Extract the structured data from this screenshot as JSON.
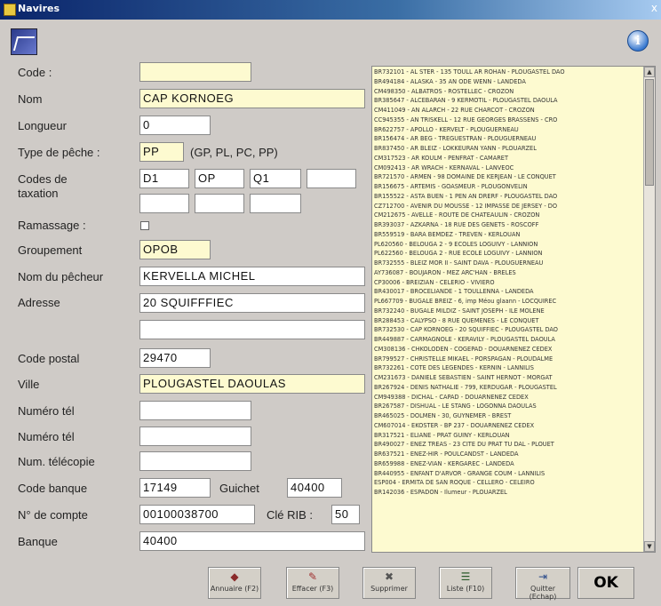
{
  "window": {
    "title": "Navires",
    "close_glyph": "x"
  },
  "labels": {
    "code": "Code :",
    "nom": "Nom",
    "longueur": "Longueur",
    "type_peche": "Type de pêche :",
    "type_peche_hint": "(GP, PL, PC, PP)",
    "codes_taxation_1": "Codes de",
    "codes_taxation_2": "taxation",
    "ramassage": "Ramassage :",
    "groupement": "Groupement",
    "nom_pecheur": "Nom du pêcheur",
    "adresse": "Adresse",
    "code_postal": "Code postal",
    "ville": "Ville",
    "numero_tel_1": "Numéro tél",
    "numero_tel_2": "Numéro tél",
    "num_telecopie": "Num. télécopie",
    "code_banque": "Code banque",
    "guichet": "Guichet",
    "numero_compte": "N° de compte",
    "cle_rib": "Clé RIB :",
    "banque": "Banque"
  },
  "fields": {
    "code": "",
    "nom": "CAP KORNOEG",
    "longueur": "0",
    "type_peche": "PP",
    "taxation_1": "D1",
    "taxation_2": "OP",
    "taxation_3": "Q1",
    "taxation_4": "",
    "taxation_5": "",
    "taxation_6": "",
    "taxation_7": "",
    "groupement": "OPOB",
    "nom_pecheur": "KERVELLA MICHEL",
    "adresse_1": "20 SQUIFFFIEC",
    "adresse_2": "",
    "code_postal": "29470",
    "ville": "PLOUGASTEL DAOULAS",
    "numero_tel_1": "",
    "numero_tel_2": "",
    "num_telecopie": "",
    "code_banque": "17149",
    "guichet": "40400",
    "numero_compte": "00100038700",
    "cle_rib": "50",
    "banque": "40400"
  },
  "list": [
    "BR732101 - AL STER - 135 TOULL AR ROHAN - PLOUGASTEL DAO",
    "BR494184 - ALASKA - 35 AN ODE WENN - LANDEDA",
    "CM498350 - ALBATROS - ROSTELLEC - CROZON",
    "BR385647 - ALCEBARAN - 9 KERMOTIL - PLOUGASTEL DAOULA",
    "CM411049 - AN ALARCH - 22 RUE CHARCOT - CROZON",
    "CC945355 - AN TRISKELL - 12 RUE GEORGES BRASSENS - CRO",
    "BR622757 - APOLLO - KERVELT - PLOUGUERNEAU",
    "BR156474 - AR BEG - TREGUESTRAN - PLOUGUERNEAU",
    "BR837450 - AR BLEIZ - LOKKEURAN YANN - PLOUARZEL",
    "CM317523 - AR KOULM - PENFRAT - CAMARET",
    "CM092413 - AR WRACH - KERNAVAL - LANVEOC",
    "BR721570 - ARMEN - 98 DOMAINE DE KERJEAN - LE CONQUET",
    "BR156675 - ARTEMIS - GOASMEUR - PLOUGONVELIN",
    "BR155522 - ASTA BUEN - 1 PEN AN DRERF - PLOUGASTEL DAO",
    "CZ712700 - AVENIR DU MOUSSE - 12 IMPASSE DE JERSEY - DO",
    "CM212675 - AVELLE - ROUTE DE CHATEAULIN - CROZON",
    "BR393037 - AZKARNA - 18 RUE DES GENETS - ROSCOFF",
    "BR559519 - BARA BEMDEZ - TREVEN - KERLOUAN",
    "PL620560 - BELOUGA 2 - 9 ECOLES LOGUIVY - LANNION",
    "PL622560 - BELOUGA 2 - RUE ECOLE LOGUIVY - LANNION",
    "BR732555 - BLEIZ MOR II - SAINT DAVA - PLOUGUERNEAU",
    "AY736087 - BOUJARON - MEZ ARC'HAN - BRELES",
    "CP30006 - BREIZIAN - CELERIO - VIVIERO",
    "BR430017 - BROCELIANDE - 1 TOULLENNA - LANDEDA",
    "PL667709 - BUGALE BREIZ - 6, imp Méou glaann - LOCQUIREC",
    "BR732240 - BUGALE MILDIZ - SAINT JOSEPH - ILE MOLENE",
    "BR288453 - CALYPSO - 8 RUE QUEMENES - LE CONQUET",
    "BR732530 - CAP KORNOEG - 20 SQUIFFIEC - PLOUGASTEL DAO",
    "BR449887 - CARMAGNOLE - KERAVILY - PLOUGASTEL DAOULA",
    "CM308136 - CHKOLODEN - COGEPAD - DOUARNENEZ CEDEX",
    "BR799527 - CHRISTELLE MIKAEL - PORSPAGAN - PLOUDALME",
    "BR732261 - COTE DES LEGENDES - KERNIN - LANNILIS",
    "CM231673 - DANIELE SEBASTIEN - SAINT HERNOT - MORGAT",
    "BR267924 - DENIS NATHALIE - 799, KERDUGAR - PLOUGASTEL",
    "CM949388 - DICHAL - CAPAD - DOUARNENEZ CEDEX",
    "BR267587 - DISHUAL - LE STANG - LOGONNA DAOULAS",
    "BR465025 - DOLMEN - 30, GUYNEMER - BREST",
    "CM607014 - EKOSTER - BP 237 - DOUARNENEZ CEDEX",
    "BR317521 - ELIANE - PRAT GUINY - KERLOUAN",
    "BR490027 - ENEZ TREAS - 23 CITE DU PRAT TU DAL - PLOUET",
    "BR637521 - ENEZ-HIR - POULCANDST - LANDEDA",
    "BR659988 - ENEZ-VIAN - KERGAREC - LANDEDA",
    "BR440955 - ENFANT D'ARVOR - GRANGE COUM - LANNILIS",
    "ESP004 - ERMITA DE SAN ROQUE - CELLERO - CELEIRO",
    "BR142036 - ESPADON - Ilumeur - PLOUARZEL"
  ],
  "buttons": {
    "annuaire": "Annuaire (F2)",
    "effacer": "Effacer (F3)",
    "supprimer": "Supprimer",
    "liste": "Liste (F10)",
    "quitter": "Quitter (Echap)",
    "ok": "OK"
  },
  "icons": {
    "info_glyph": "i"
  }
}
